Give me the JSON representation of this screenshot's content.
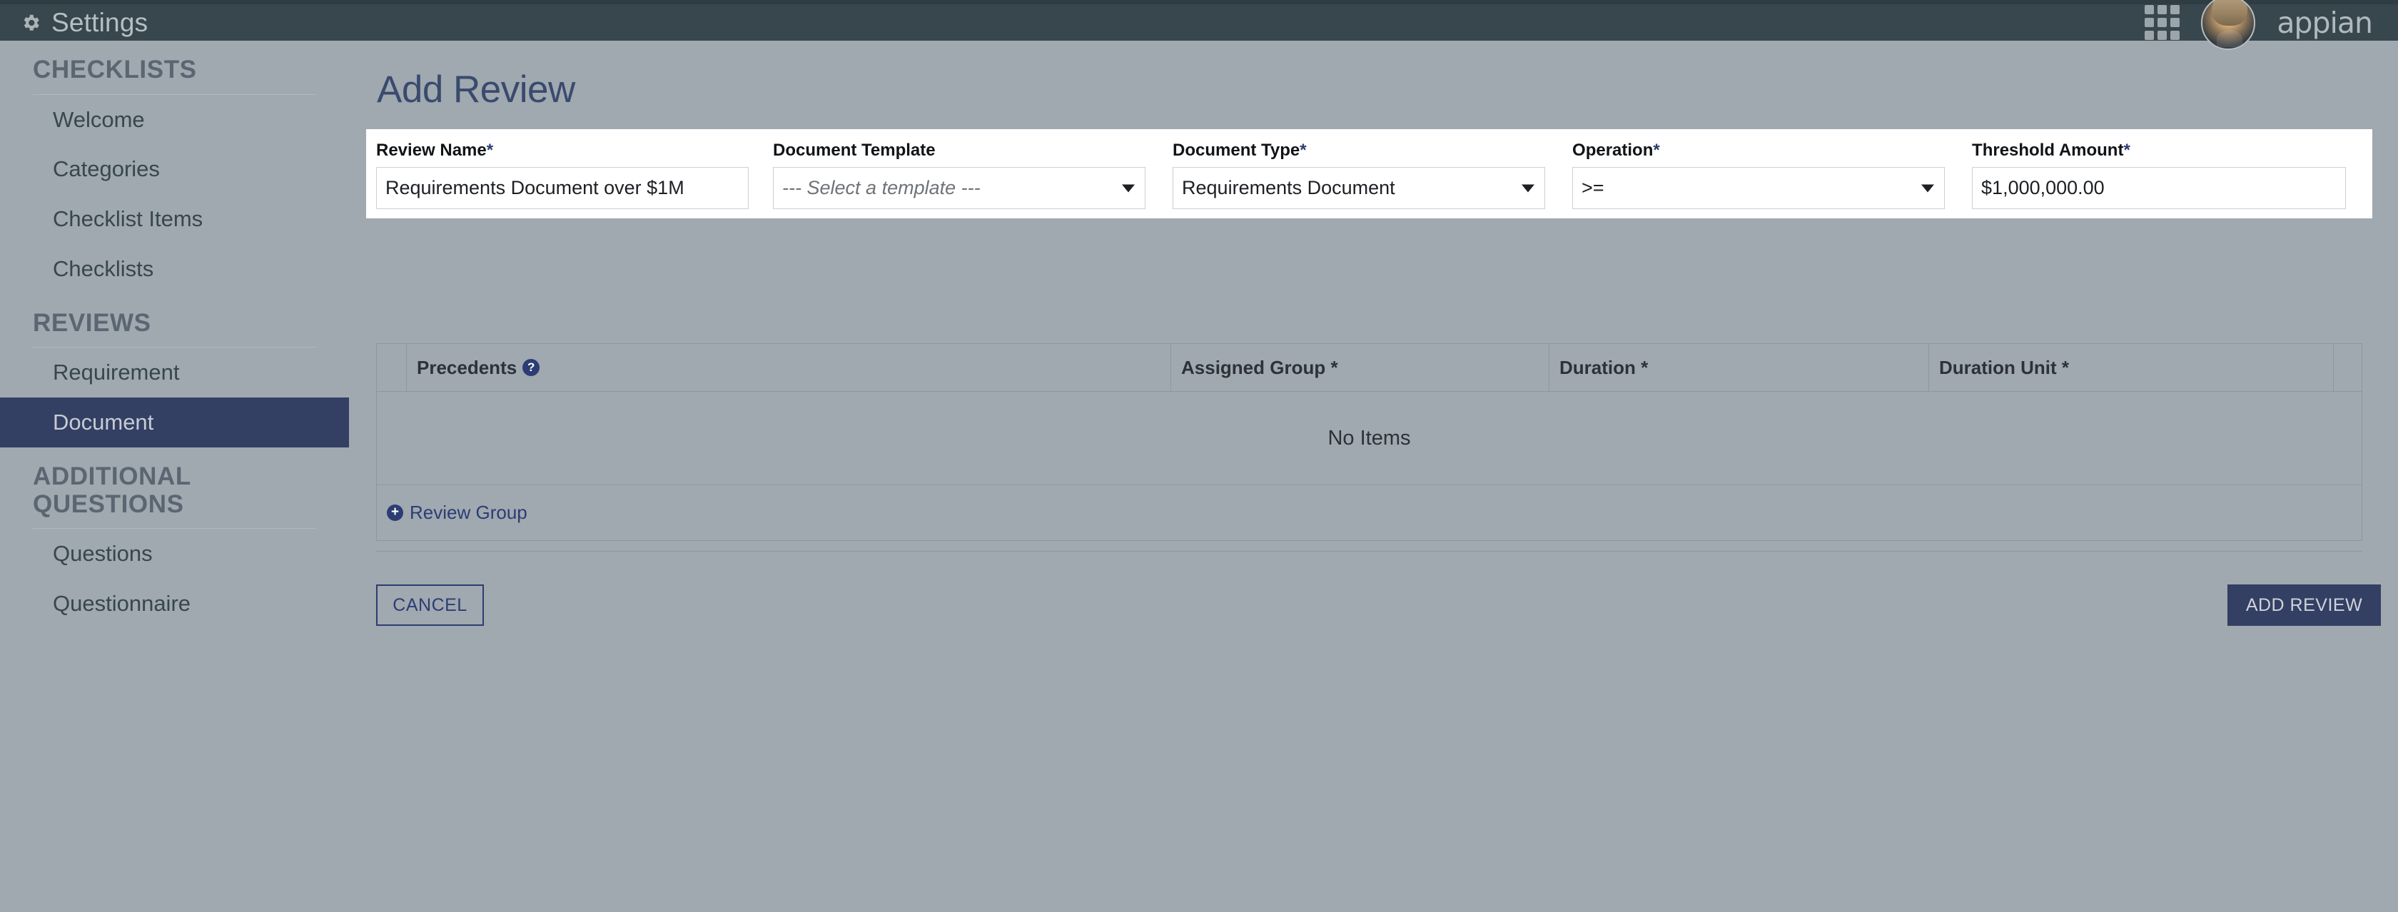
{
  "topbar": {
    "gear_icon": "gear-icon",
    "title": "Settings",
    "apps_icon": "grid-apps-icon",
    "avatar": "user-avatar",
    "logo": "appian"
  },
  "sidebar": {
    "sections": [
      {
        "heading": "CHECKLISTS",
        "items": [
          {
            "label": "Welcome",
            "active": false
          },
          {
            "label": "Categories",
            "active": false
          },
          {
            "label": "Checklist Items",
            "active": false
          },
          {
            "label": "Checklists",
            "active": false
          }
        ]
      },
      {
        "heading": "REVIEWS",
        "items": [
          {
            "label": "Requirement",
            "active": false
          },
          {
            "label": "Document",
            "active": true
          }
        ]
      },
      {
        "heading": "ADDITIONAL QUESTIONS",
        "items": [
          {
            "label": "Questions",
            "active": false
          },
          {
            "label": "Questionnaire",
            "active": false
          }
        ]
      }
    ]
  },
  "main": {
    "page_title": "Add Review",
    "form": {
      "review_name": {
        "label": "Review Name",
        "required": "*",
        "value": "Requirements Document over $1M"
      },
      "document_template": {
        "label": "Document Template",
        "required": "",
        "value": "--- Select a template ---"
      },
      "document_type": {
        "label": "Document Type",
        "required": "*",
        "value": "Requirements Document"
      },
      "operation": {
        "label": "Operation",
        "required": "*",
        "value": ">="
      },
      "threshold_amount": {
        "label": "Threshold Amount",
        "required": "*",
        "value": "$1,000,000.00"
      }
    },
    "grid": {
      "columns": [
        {
          "label": "",
          "required": ""
        },
        {
          "label": "Precedents",
          "required": "",
          "help": "?"
        },
        {
          "label": "Assigned Group",
          "required": "*"
        },
        {
          "label": "Duration",
          "required": "*"
        },
        {
          "label": "Duration Unit",
          "required": "*"
        },
        {
          "label": "",
          "required": ""
        }
      ],
      "empty_message": "No Items",
      "add_link": "Review Group",
      "add_icon": "plus-circle-icon"
    },
    "buttons": {
      "cancel": "CANCEL",
      "submit": "ADD REVIEW"
    }
  },
  "colors": {
    "topbar_bg": "#37474d",
    "page_bg": "#a0a8b0",
    "accent_navy": "#333f63",
    "link_navy": "#2b3d73",
    "title_navy": "#394a6d"
  }
}
